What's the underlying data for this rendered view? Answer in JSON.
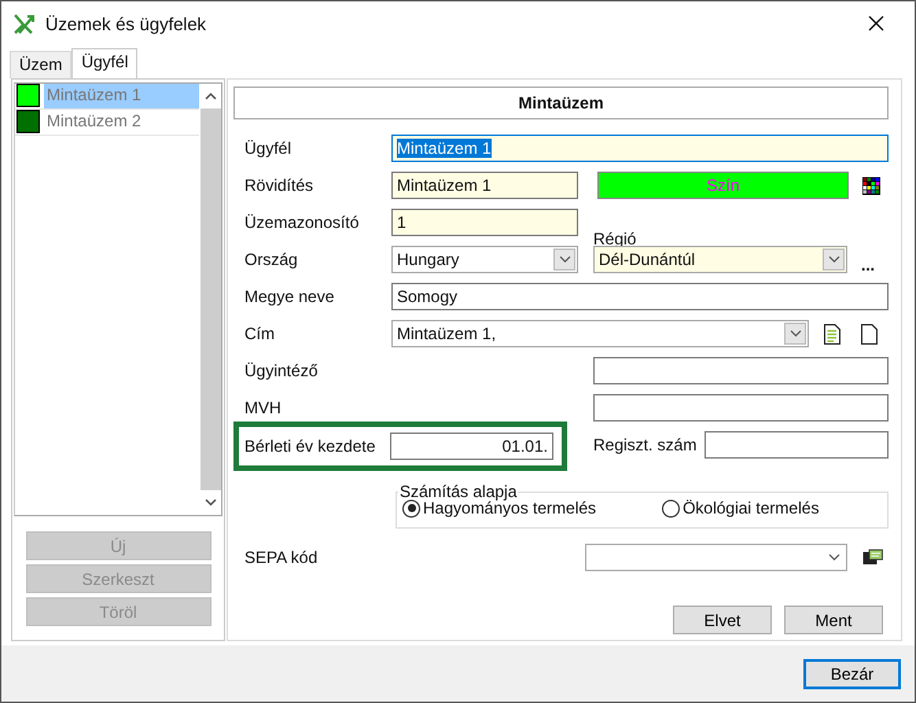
{
  "window": {
    "title": "Üzemek és ügyfelek"
  },
  "tabs": [
    {
      "label": "Üzem",
      "selected": false
    },
    {
      "label": "Ügyfél",
      "selected": true
    }
  ],
  "list": [
    {
      "label": "Mintaüzem 1",
      "color": "#00ff00",
      "selected": true
    },
    {
      "label": "Mintaüzem 2",
      "color": "#007000",
      "selected": false
    }
  ],
  "list_buttons": [
    {
      "label": "Új",
      "disabled": true
    },
    {
      "label": "Szerkeszt",
      "disabled": true
    },
    {
      "label": "Töröl",
      "disabled": true
    }
  ],
  "form": {
    "header": "Mintaüzem",
    "client": {
      "label": "Ügyfél",
      "value": "Mintaüzem 1",
      "focused": true
    },
    "short_name": {
      "label": "Rövidítés",
      "value": "Mintaüzem 1"
    },
    "color_button": {
      "label": "Szín",
      "color": "#00ff00"
    },
    "plant_id": {
      "label": "Üzemazonosító",
      "value": "1"
    },
    "region_label": "Régió",
    "country": {
      "label": "Ország",
      "value": "Hungary"
    },
    "region": {
      "value": "Dél-Dunántúl"
    },
    "more_button": "...",
    "county": {
      "label": "Megye neve",
      "value": "Somogy"
    },
    "address": {
      "label": "Cím",
      "value": "Mintaüzem 1,"
    },
    "administrator": {
      "label": "Ügyintéző"
    },
    "mvh": {
      "label": "MVH"
    },
    "lease_start": {
      "label": "Bérleti év kezdete",
      "value": "01.01.",
      "highlighted": true
    },
    "reg_number": {
      "label": "Regiszt. szám"
    },
    "calculation": {
      "title": "Számítás alapja",
      "options": [
        {
          "label": "Hagyományos termelés",
          "selected": true
        },
        {
          "label": "Ökológiai termelés",
          "selected": false
        }
      ]
    },
    "sepa": {
      "label": "SEPA kód"
    },
    "buttons": [
      "Elvet",
      "Ment"
    ]
  },
  "close_button": "Bezár"
}
